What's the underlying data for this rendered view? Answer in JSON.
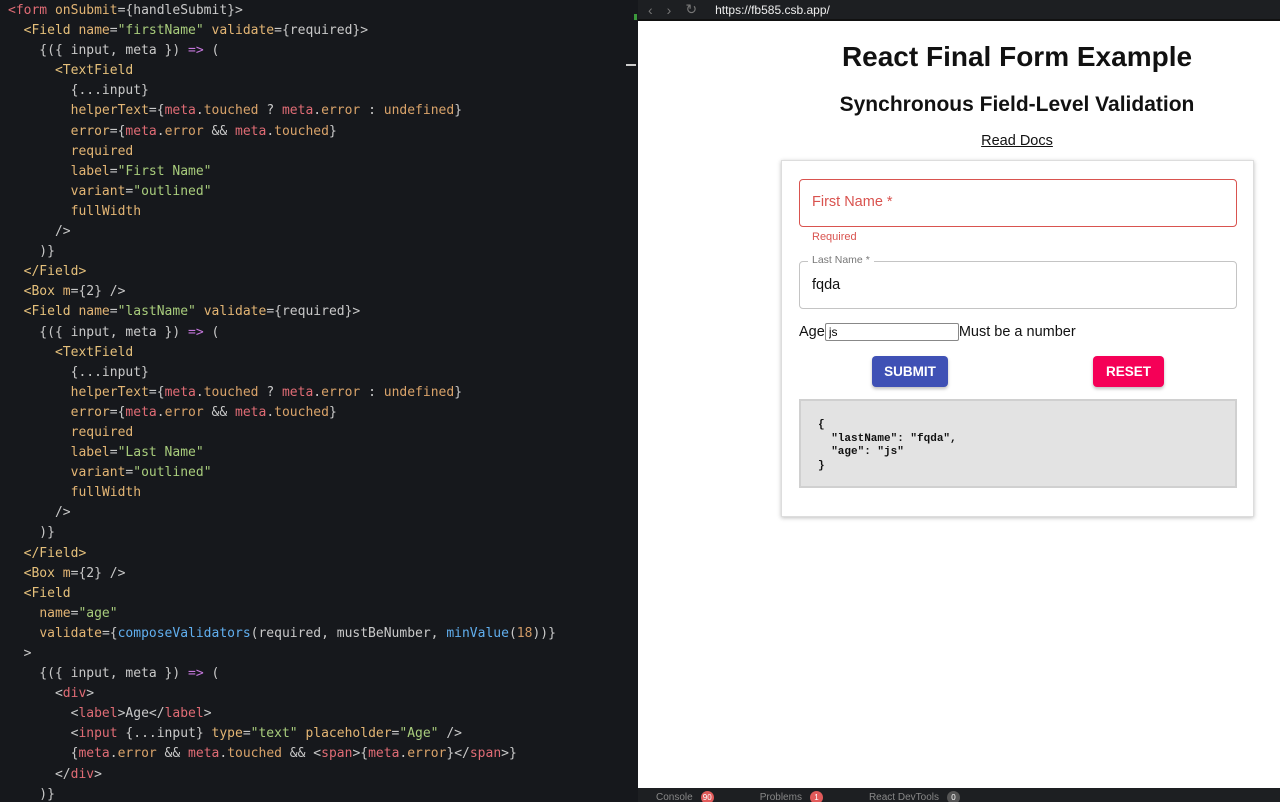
{
  "editor": {
    "lines": [
      [
        [
          "t",
          "<form"
        ],
        [
          "p",
          " "
        ],
        [
          "a",
          "onSubmit"
        ],
        [
          "p",
          "={handleSubmit}>"
        ]
      ],
      [
        [
          "p",
          "  "
        ],
        [
          "c",
          "<Field"
        ],
        [
          "p",
          " "
        ],
        [
          "a",
          "name"
        ],
        [
          "p",
          "="
        ],
        [
          "s",
          "\"firstName\""
        ],
        [
          "p",
          " "
        ],
        [
          "a",
          "validate"
        ],
        [
          "p",
          "={required}>"
        ]
      ],
      [
        [
          "p",
          "    {({ input, meta }) "
        ],
        [
          "k",
          "=>"
        ],
        [
          "p",
          " ("
        ]
      ],
      [
        [
          "p",
          "      "
        ],
        [
          "c",
          "<TextField"
        ]
      ],
      [
        [
          "p",
          "        {...input}"
        ]
      ],
      [
        [
          "p",
          "        "
        ],
        [
          "a",
          "helperText"
        ],
        [
          "p",
          "={"
        ],
        [
          "v",
          "meta"
        ],
        [
          "p",
          "."
        ],
        [
          "pr",
          "touched"
        ],
        [
          "p",
          " ? "
        ],
        [
          "v",
          "meta"
        ],
        [
          "p",
          "."
        ],
        [
          "pr",
          "error"
        ],
        [
          "p",
          " : "
        ],
        [
          "pr",
          "undefined"
        ],
        [
          "p",
          "}"
        ]
      ],
      [
        [
          "p",
          "        "
        ],
        [
          "a",
          "error"
        ],
        [
          "p",
          "={"
        ],
        [
          "v",
          "meta"
        ],
        [
          "p",
          "."
        ],
        [
          "pr",
          "error"
        ],
        [
          "p",
          " && "
        ],
        [
          "v",
          "meta"
        ],
        [
          "p",
          "."
        ],
        [
          "pr",
          "touched"
        ],
        [
          "p",
          "}"
        ]
      ],
      [
        [
          "p",
          "        "
        ],
        [
          "a",
          "required"
        ]
      ],
      [
        [
          "p",
          "        "
        ],
        [
          "a",
          "label"
        ],
        [
          "p",
          "="
        ],
        [
          "s",
          "\"First Name\""
        ]
      ],
      [
        [
          "p",
          "        "
        ],
        [
          "a",
          "variant"
        ],
        [
          "p",
          "="
        ],
        [
          "s",
          "\"outlined\""
        ]
      ],
      [
        [
          "p",
          "        "
        ],
        [
          "a",
          "fullWidth"
        ]
      ],
      [
        [
          "p",
          "      />"
        ]
      ],
      [
        [
          "p",
          "    )}"
        ]
      ],
      [
        [
          "p",
          "  "
        ],
        [
          "c",
          "</Field>"
        ]
      ],
      [
        [
          "p",
          "  "
        ],
        [
          "c",
          "<Box"
        ],
        [
          "p",
          " "
        ],
        [
          "a",
          "m"
        ],
        [
          "p",
          "={2} />"
        ]
      ],
      [
        [
          "p",
          "  "
        ],
        [
          "c",
          "<Field"
        ],
        [
          "p",
          " "
        ],
        [
          "a",
          "name"
        ],
        [
          "p",
          "="
        ],
        [
          "s",
          "\"lastName\""
        ],
        [
          "p",
          " "
        ],
        [
          "a",
          "validate"
        ],
        [
          "p",
          "={required}>"
        ]
      ],
      [
        [
          "p",
          "    {({ input, meta }) "
        ],
        [
          "k",
          "=>"
        ],
        [
          "p",
          " ("
        ]
      ],
      [
        [
          "p",
          "      "
        ],
        [
          "c",
          "<TextField"
        ]
      ],
      [
        [
          "p",
          "        {...input}"
        ]
      ],
      [
        [
          "p",
          "        "
        ],
        [
          "a",
          "helperText"
        ],
        [
          "p",
          "={"
        ],
        [
          "v",
          "meta"
        ],
        [
          "p",
          "."
        ],
        [
          "pr",
          "touched"
        ],
        [
          "p",
          " ? "
        ],
        [
          "v",
          "meta"
        ],
        [
          "p",
          "."
        ],
        [
          "pr",
          "error"
        ],
        [
          "p",
          " : "
        ],
        [
          "pr",
          "undefined"
        ],
        [
          "p",
          "}"
        ]
      ],
      [
        [
          "p",
          "        "
        ],
        [
          "a",
          "error"
        ],
        [
          "p",
          "={"
        ],
        [
          "v",
          "meta"
        ],
        [
          "p",
          "."
        ],
        [
          "pr",
          "error"
        ],
        [
          "p",
          " && "
        ],
        [
          "v",
          "meta"
        ],
        [
          "p",
          "."
        ],
        [
          "pr",
          "touched"
        ],
        [
          "p",
          "}"
        ]
      ],
      [
        [
          "p",
          "        "
        ],
        [
          "a",
          "required"
        ]
      ],
      [
        [
          "p",
          "        "
        ],
        [
          "a",
          "label"
        ],
        [
          "p",
          "="
        ],
        [
          "s",
          "\"Last Name\""
        ]
      ],
      [
        [
          "p",
          "        "
        ],
        [
          "a",
          "variant"
        ],
        [
          "p",
          "="
        ],
        [
          "s",
          "\"outlined\""
        ]
      ],
      [
        [
          "p",
          "        "
        ],
        [
          "a",
          "fullWidth"
        ]
      ],
      [
        [
          "p",
          "      />"
        ]
      ],
      [
        [
          "p",
          "    )}"
        ]
      ],
      [
        [
          "p",
          "  "
        ],
        [
          "c",
          "</Field>"
        ]
      ],
      [
        [
          "p",
          "  "
        ],
        [
          "c",
          "<Box"
        ],
        [
          "p",
          " "
        ],
        [
          "a",
          "m"
        ],
        [
          "p",
          "={2} />"
        ]
      ],
      [
        [
          "p",
          "  "
        ],
        [
          "c",
          "<Field"
        ]
      ],
      [
        [
          "p",
          "    "
        ],
        [
          "a",
          "name"
        ],
        [
          "p",
          "="
        ],
        [
          "s",
          "\"age\""
        ]
      ],
      [
        [
          "p",
          "    "
        ],
        [
          "a",
          "validate"
        ],
        [
          "p",
          "={"
        ],
        [
          "f",
          "composeValidators"
        ],
        [
          "p",
          "(required, mustBeNumber, "
        ],
        [
          "f",
          "minValue"
        ],
        [
          "p",
          "("
        ],
        [
          "n",
          "18"
        ],
        [
          "p",
          "))}"
        ]
      ],
      [
        [
          "p",
          "  >"
        ]
      ],
      [
        [
          "p",
          "    {({ input, meta }) "
        ],
        [
          "k",
          "=>"
        ],
        [
          "p",
          " ("
        ]
      ],
      [
        [
          "p",
          "      <"
        ],
        [
          "t",
          "div"
        ],
        [
          "p",
          ">"
        ]
      ],
      [
        [
          "p",
          "        <"
        ],
        [
          "t",
          "label"
        ],
        [
          "p",
          ">Age</"
        ],
        [
          "t",
          "label"
        ],
        [
          "p",
          ">"
        ]
      ],
      [
        [
          "p",
          "        <"
        ],
        [
          "t",
          "input"
        ],
        [
          "p",
          " {...input} "
        ],
        [
          "a",
          "type"
        ],
        [
          "p",
          "="
        ],
        [
          "s",
          "\"text\""
        ],
        [
          "p",
          " "
        ],
        [
          "a",
          "placeholder"
        ],
        [
          "p",
          "="
        ],
        [
          "s",
          "\"Age\""
        ],
        [
          "p",
          " />"
        ]
      ],
      [
        [
          "p",
          "        {"
        ],
        [
          "v",
          "meta"
        ],
        [
          "p",
          "."
        ],
        [
          "pr",
          "error"
        ],
        [
          "p",
          " && "
        ],
        [
          "v",
          "meta"
        ],
        [
          "p",
          "."
        ],
        [
          "pr",
          "touched"
        ],
        [
          "p",
          " && <"
        ],
        [
          "t",
          "span"
        ],
        [
          "p",
          ">{"
        ],
        [
          "v",
          "meta"
        ],
        [
          "p",
          "."
        ],
        [
          "pr",
          "error"
        ],
        [
          "p",
          "}</"
        ],
        [
          "t",
          "span"
        ],
        [
          "p",
          ">}"
        ]
      ],
      [
        [
          "p",
          "      </"
        ],
        [
          "t",
          "div"
        ],
        [
          "p",
          ">"
        ]
      ],
      [
        [
          "p",
          "    )}"
        ]
      ]
    ]
  },
  "browser": {
    "url": "https://fb585.csb.app/",
    "back": "‹",
    "forward": "›",
    "reload": "↻"
  },
  "page": {
    "title": "React Final Form Example",
    "subtitle": "Synchronous Field-Level Validation",
    "docs_link": "Read Docs",
    "first_name": {
      "label": "First Name *",
      "helper": "Required"
    },
    "last_name": {
      "label": "Last Name *",
      "value": "fqda"
    },
    "age": {
      "label": "Age",
      "value": "js",
      "error": "Must be a number"
    },
    "submit": "SUBMIT",
    "reset": "RESET",
    "values_json": "{\n  \"lastName\": \"fqda\",\n  \"age\": \"js\"\n}"
  },
  "bottom_tabs": [
    {
      "label": "Console",
      "count": "90",
      "color": "#e05a5a"
    },
    {
      "label": "Problems",
      "count": "1",
      "color": "#e05a5a"
    },
    {
      "label": "React DevTools",
      "count": "0",
      "color": "#555555"
    }
  ]
}
